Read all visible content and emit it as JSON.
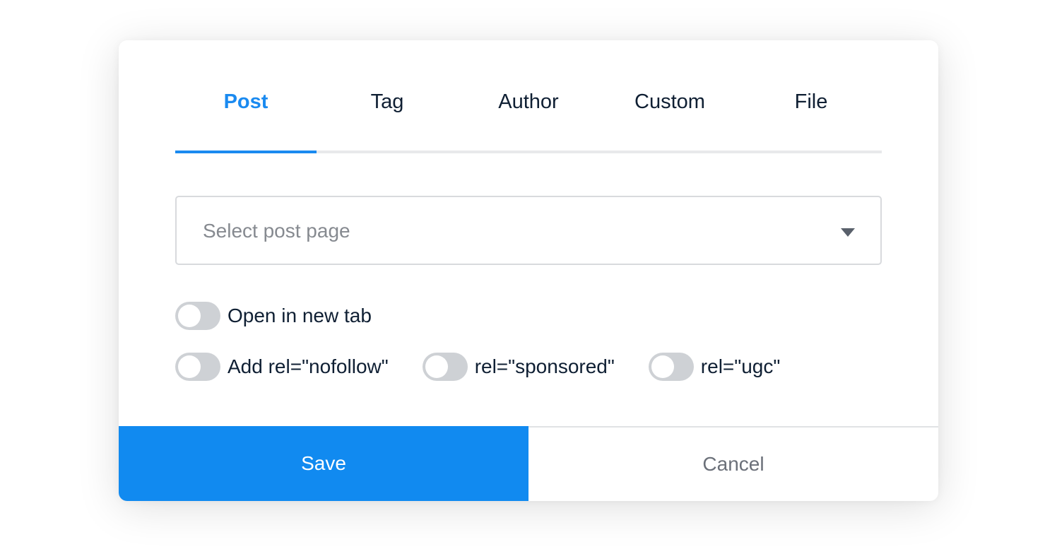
{
  "tabs": [
    {
      "label": "Post",
      "active": true
    },
    {
      "label": "Tag",
      "active": false
    },
    {
      "label": "Author",
      "active": false
    },
    {
      "label": "Custom",
      "active": false
    },
    {
      "label": "File",
      "active": false
    }
  ],
  "select": {
    "placeholder": "Select post page",
    "icon": "caret-down-icon"
  },
  "toggles": {
    "open_new_tab": {
      "label": "Open in new tab",
      "on": false
    },
    "nofollow": {
      "label": "Add rel=\"nofollow\"",
      "on": false
    },
    "sponsored": {
      "label": "rel=\"sponsored\"",
      "on": false
    },
    "ugc": {
      "label": "rel=\"ugc\"",
      "on": false
    }
  },
  "footer": {
    "save_label": "Save",
    "cancel_label": "Cancel"
  },
  "colors": {
    "accent": "#118af0",
    "text": "#0f1f33",
    "toggle_off": "#ced1d5"
  }
}
